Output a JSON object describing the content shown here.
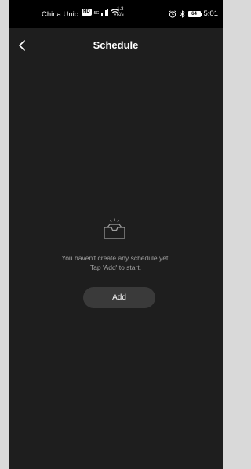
{
  "status_bar": {
    "carrier": "China Unic...",
    "hd_badge": "HD",
    "network": "5G",
    "speed_value": "1.3",
    "speed_unit": "K/s",
    "battery": "64",
    "time": "5:01"
  },
  "header": {
    "title": "Schedule"
  },
  "empty_state": {
    "line1": "You haven't create any schedule yet.",
    "line2": "Tap 'Add' to start.",
    "add_label": "Add"
  }
}
